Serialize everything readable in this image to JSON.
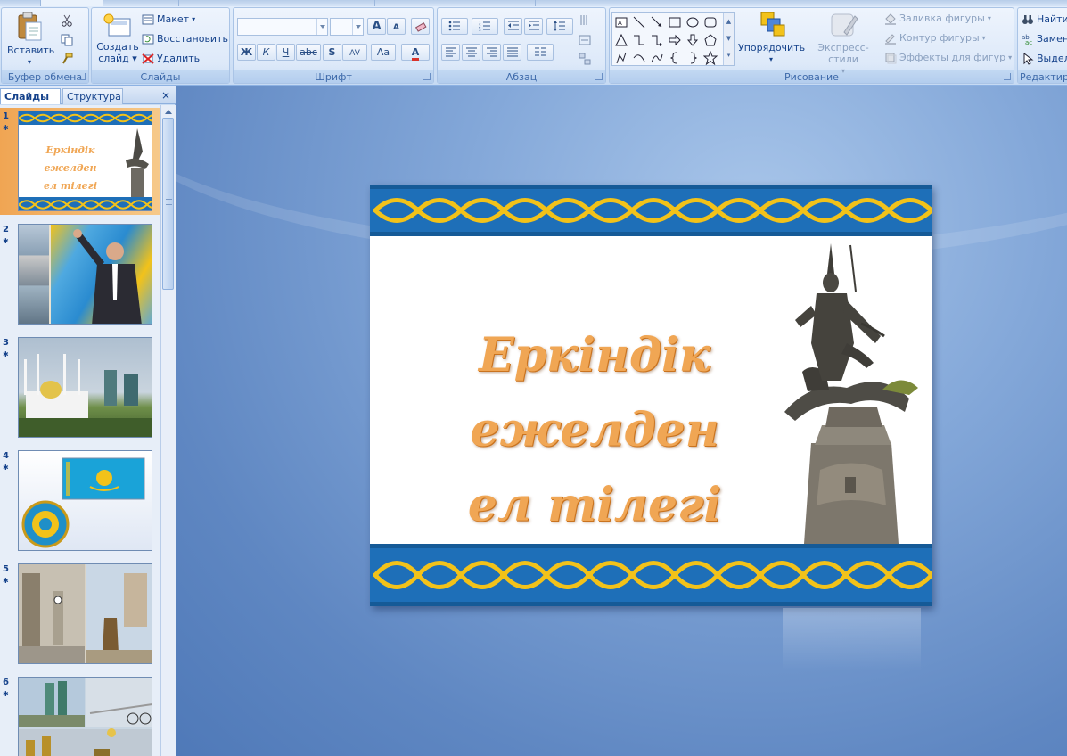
{
  "ribbon": {
    "clipboard": {
      "label": "Буфер обмена",
      "paste": "Вставить"
    },
    "slides": {
      "label": "Слайды",
      "create_line1": "Создать",
      "create_line2": "слайд",
      "layout": "Макет",
      "reset": "Восстановить",
      "delete": "Удалить"
    },
    "font": {
      "label": "Шрифт",
      "bold": "Ж",
      "italic": "К",
      "underline": "Ч",
      "strike": "abc",
      "shadow": "S",
      "spacing": "AV",
      "case": "Aa",
      "color": "A",
      "grow": "A",
      "shrink": "A"
    },
    "paragraph": {
      "label": "Абзац"
    },
    "drawing": {
      "label": "Рисование",
      "arrange": "Упорядочить",
      "quick_styles": "Экспресс-стили",
      "shape_fill": "Заливка фигуры",
      "shape_outline": "Контур фигуры",
      "shape_effects": "Эффекты для фигур"
    },
    "editing": {
      "label": "Редактиров",
      "find": "Найти",
      "replace": "Замен",
      "select": "Выдел"
    }
  },
  "panel": {
    "tab_slides": "Слайды",
    "tab_outline": "Структура",
    "close": "×",
    "thumbnails": [
      {
        "num": "1",
        "selected": true
      },
      {
        "num": "2",
        "selected": false
      },
      {
        "num": "3",
        "selected": false
      },
      {
        "num": "4",
        "selected": false
      },
      {
        "num": "5",
        "selected": false
      },
      {
        "num": "6",
        "selected": false
      }
    ],
    "thumb1_title_line1": "Еркіндік ежелден",
    "thumb1_title_line2": "ел тілегі"
  },
  "slide": {
    "title_line1": "Еркіндік ежелден",
    "title_line2": "ел тілегі"
  },
  "colors": {
    "ornament_blue": "#1e6fb8",
    "ornament_gold": "#f2c21a",
    "title_orange": "#f0a654",
    "selection_orange": "#f0a553"
  }
}
